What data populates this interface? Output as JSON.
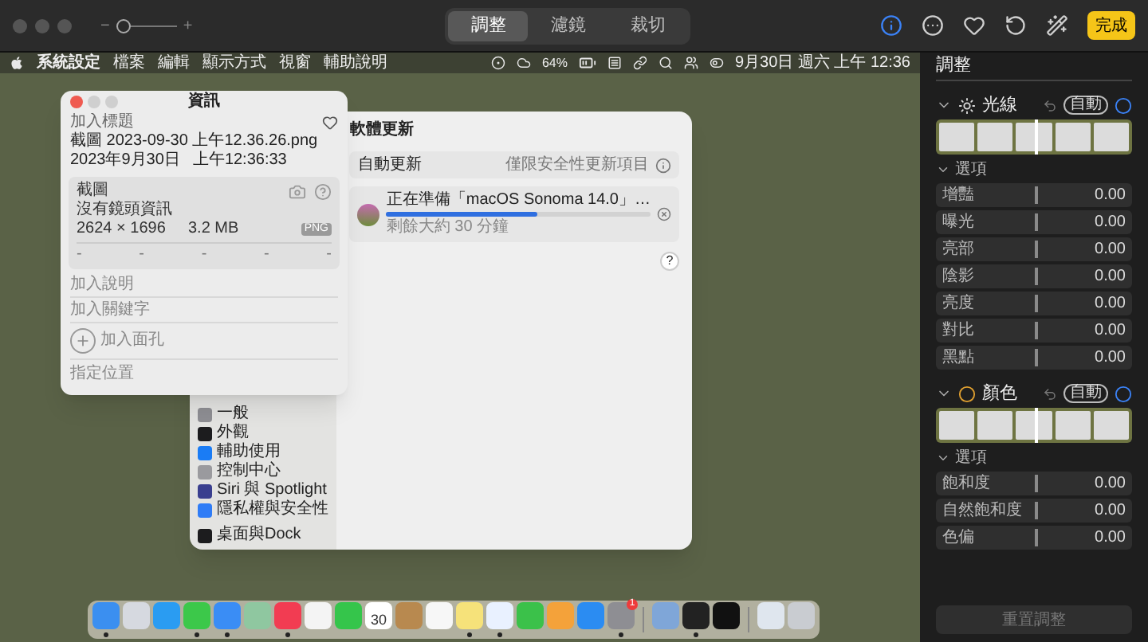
{
  "toolbar": {
    "zoom": {
      "minus": "−",
      "plus": "+",
      "level": 0.1
    },
    "tabs": [
      {
        "label": "調整",
        "selected": true
      },
      {
        "label": "濾鏡",
        "selected": false
      },
      {
        "label": "裁切",
        "selected": false
      }
    ],
    "info_active": true,
    "done_button": "完成"
  },
  "screenshot": {
    "menu_bar": {
      "app": "系統設定",
      "items": [
        "檔案",
        "編輯",
        "顯示方式",
        "視窗",
        "輔助說明"
      ],
      "battery": "64%",
      "clock": "9月30日 週六 上午 12:36"
    },
    "info_window": {
      "title": "資訊",
      "title_placeholder": "加入標題",
      "favorite": false,
      "filename": "截圖 2023-09-30 上午12.36.26.png",
      "date": "2023年9月30日",
      "time": "上午12:36:33",
      "kind": "截圖",
      "lens": "沒有鏡頭資訊",
      "dimensions": "2624 × 1696",
      "size": "3.2 MB",
      "format": "PNG",
      "exif": [
        "-",
        "-",
        "-",
        "-",
        "-"
      ],
      "caption_placeholder": "加入說明",
      "keywords_placeholder": "加入關鍵字",
      "faces": "加入面孔",
      "location": "指定位置"
    },
    "settings_window": {
      "sidebar": [
        {
          "label": "一般",
          "color": "#8e8e93"
        },
        {
          "label": "外觀",
          "color": "#1c1c1e"
        },
        {
          "label": "輔助使用",
          "color": "#1a7cf5"
        },
        {
          "label": "控制中心",
          "color": "#9a9a9e"
        },
        {
          "label": "Siri 與 Spotlight",
          "color": "#3a3f8f"
        },
        {
          "label": "隱私權與安全性",
          "color": "#2f7cf6"
        },
        {
          "label": "桌面與Dock",
          "color": "#1c1c1e"
        }
      ],
      "title": "軟體更新",
      "auto_update_label": "自動更新",
      "auto_update_value": "僅限安全性更新項目",
      "update": {
        "name": "正在準備「macOS Sonoma 14.0」…",
        "level": 0.57,
        "remaining": "剩餘大約 30 分鐘"
      },
      "help": "?"
    },
    "dock": [
      {
        "kind": "app",
        "color": "#3b8ff0",
        "running": true
      },
      {
        "kind": "app",
        "color": "#d6d9e0",
        "running": false
      },
      {
        "kind": "app",
        "color": "#2a9cf2",
        "running": false
      },
      {
        "kind": "app",
        "color": "#3cc84a",
        "running": true
      },
      {
        "kind": "app",
        "color": "#3a8df5",
        "running": true
      },
      {
        "kind": "app",
        "color": "#8fc7a0",
        "running": false
      },
      {
        "kind": "app",
        "color": "#f23c52",
        "running": true
      },
      {
        "kind": "app",
        "color": "#f4f4f4",
        "running": false
      },
      {
        "kind": "app",
        "color": "#35c54b",
        "running": false
      },
      {
        "kind": "calendar",
        "color": "#ffffff",
        "label": "30",
        "running": false
      },
      {
        "kind": "app",
        "color": "#b8894f",
        "running": false
      },
      {
        "kind": "app",
        "color": "#f7f7f7",
        "running": false
      },
      {
        "kind": "app",
        "color": "#f6e27a",
        "running": true
      },
      {
        "kind": "app",
        "color": "#e9f1ff",
        "running": true
      },
      {
        "kind": "app",
        "color": "#3bc14a",
        "running": false
      },
      {
        "kind": "app",
        "color": "#f4a23a",
        "running": false
      },
      {
        "kind": "app",
        "color": "#2b8cf2",
        "running": false
      },
      {
        "kind": "app",
        "color": "#8e8e93",
        "running": true,
        "badge": "1"
      },
      {
        "kind": "separator"
      },
      {
        "kind": "app",
        "color": "#7fa6d8",
        "running": false
      },
      {
        "kind": "app",
        "color": "#222222",
        "running": true
      },
      {
        "kind": "app",
        "color": "#111111",
        "running": false
      },
      {
        "kind": "separator"
      },
      {
        "kind": "app",
        "color": "#dfe6ee",
        "running": false
      },
      {
        "kind": "app",
        "color": "#c9ccd1",
        "running": false
      }
    ]
  },
  "panel": {
    "title": "調整",
    "sections": [
      {
        "kind": "light",
        "title": "光線",
        "expanded": true,
        "auto": "自動",
        "options_label": "選項",
        "options_expanded": true,
        "rows": [
          {
            "label": "增豔",
            "value": "0.00",
            "level": 0.5
          },
          {
            "label": "曝光",
            "value": "0.00",
            "level": 0.5
          },
          {
            "label": "亮部",
            "value": "0.00",
            "level": 0.5
          },
          {
            "label": "陰影",
            "value": "0.00",
            "level": 0.5
          },
          {
            "label": "亮度",
            "value": "0.00",
            "level": 0.5
          },
          {
            "label": "對比",
            "value": "0.00",
            "level": 0.5
          },
          {
            "label": "黑點",
            "value": "0.00",
            "level": 0.5
          }
        ]
      },
      {
        "kind": "color",
        "title": "顏色",
        "expanded": true,
        "auto": "自動",
        "options_label": "選項",
        "options_expanded": true,
        "rows": [
          {
            "label": "飽和度",
            "value": "0.00",
            "level": 0.5
          },
          {
            "label": "自然飽和度",
            "value": "0.00",
            "level": 0.5
          },
          {
            "label": "色偏",
            "value": "0.00",
            "level": 0.5
          }
        ]
      }
    ],
    "reset_button": {
      "label": "重置調整",
      "disabled": true
    }
  }
}
